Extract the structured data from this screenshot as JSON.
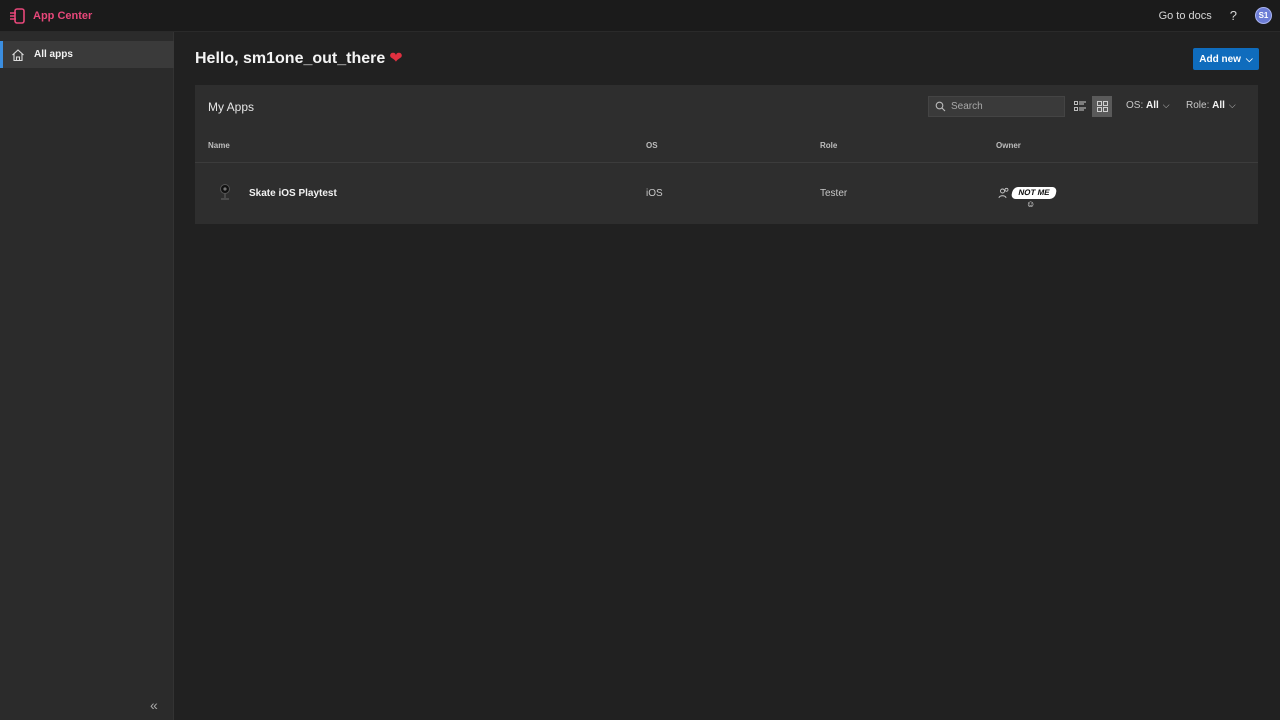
{
  "topbar": {
    "app_name": "App Center",
    "docs_label": "Go to docs",
    "help_label": "?",
    "avatar_initials": "S1",
    "brand_color": "#e8477a"
  },
  "sidebar": {
    "items": [
      {
        "label": "All apps",
        "icon": "home-icon",
        "active": true
      }
    ],
    "collapse_label": "«"
  },
  "main": {
    "greeting": "Hello, sm1one_out_there",
    "greeting_emoji": "❤",
    "add_new_label": "Add new",
    "add_new_color": "#0f6cbd"
  },
  "my_apps": {
    "title": "My Apps",
    "search": {
      "placeholder": "Search",
      "value": ""
    },
    "filters": {
      "os_label": "OS:",
      "os_value": "All",
      "role_label": "Role:",
      "role_value": "All"
    },
    "view_mode": "grid",
    "columns": [
      "Name",
      "OS",
      "Role",
      "Owner"
    ],
    "rows": [
      {
        "name": "Skate iOS Playtest",
        "os": "iOS",
        "role": "Tester",
        "owner": "NOT ME"
      }
    ]
  }
}
